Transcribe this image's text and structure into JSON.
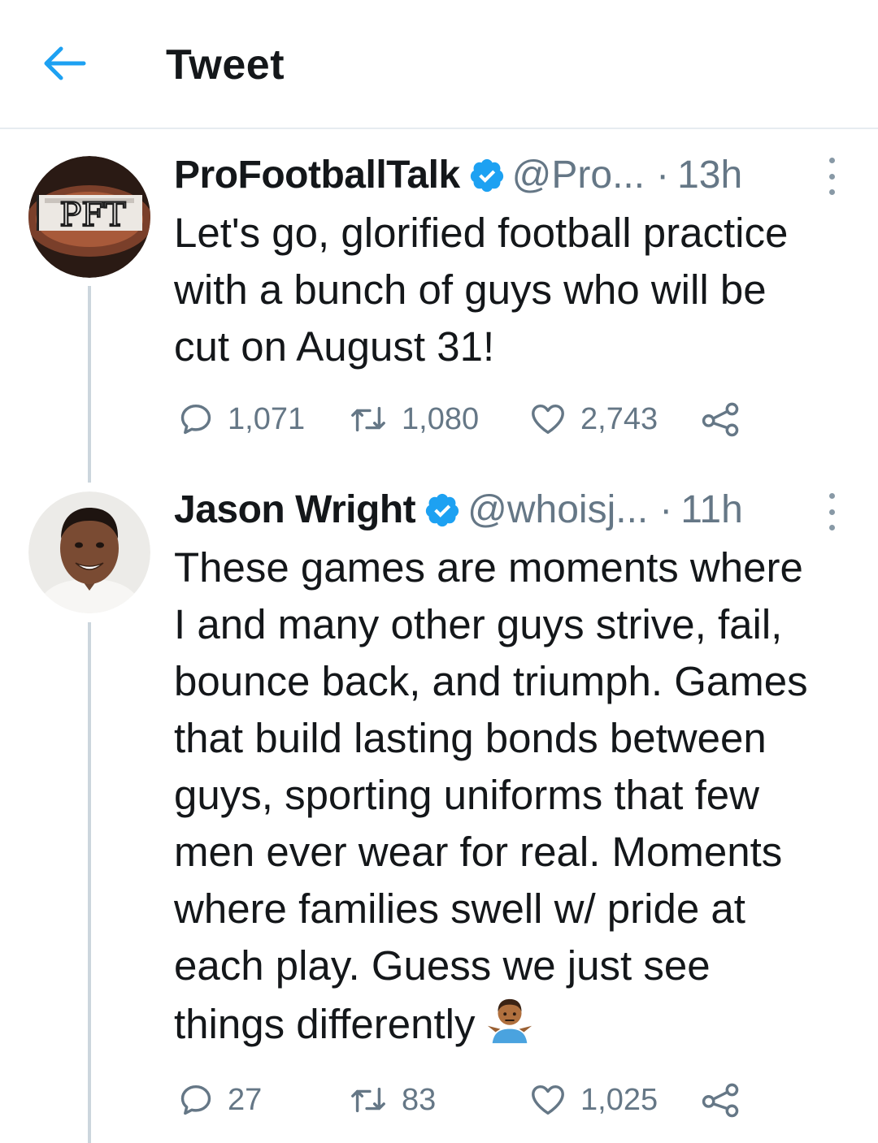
{
  "header": {
    "title": "Tweet"
  },
  "tweets": [
    {
      "name": "ProFootballTalk",
      "handle": "@Pro...",
      "dot": "·",
      "time": "13h",
      "avatar_text": "PFT",
      "text": "Let's go, glorified football practice\nwith a bunch of guys who will be\ncut on August 31!",
      "replies": "1,071",
      "retweets": "1,080",
      "likes": "2,743"
    },
    {
      "name": "Jason Wright",
      "handle": "@whoisj...",
      "dot": "·",
      "time": "11h",
      "text": "These games are moments where\nI and many other guys strive, fail,\nbounce back, and triumph. Games\nthat build lasting bonds between\nguys, sporting uniforms that few\nmen ever wear for real. Moments\nwhere families swell w/ pride at\neach play. Guess we just see\nthings differently",
      "emoji": "🤷🏾‍♂️",
      "replies": "27",
      "retweets": "83",
      "likes": "1,025"
    }
  ],
  "colors": {
    "accent": "#1da1f2",
    "secondary_text": "#657786",
    "divider": "#e6ecf0",
    "thread_line": "#ccd6dd"
  }
}
